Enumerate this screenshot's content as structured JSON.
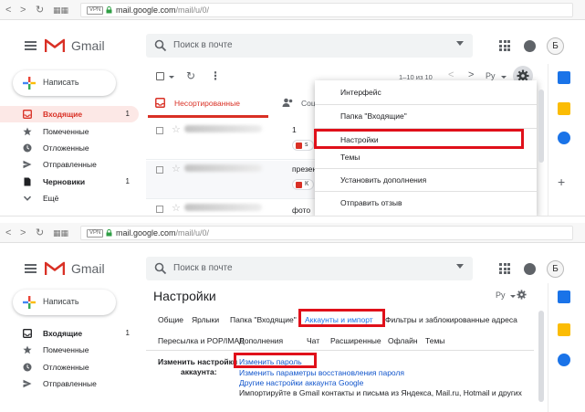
{
  "browser": {
    "vpn": "VPN",
    "url_host": "mail.google.com",
    "url_path": "/mail/u/0/"
  },
  "header": {
    "brand": "Gmail",
    "search_placeholder": "Поиск в почте",
    "avatar_letter": "Б"
  },
  "sidebar": {
    "compose_label": "Написать",
    "items": [
      {
        "label": "Входящие",
        "count": "1",
        "icon": "inbox-icon"
      },
      {
        "label": "Помеченные",
        "count": "",
        "icon": "star-icon"
      },
      {
        "label": "Отложенные",
        "count": "",
        "icon": "clock-icon"
      },
      {
        "label": "Отправленные",
        "count": "",
        "icon": "send-icon"
      },
      {
        "label": "Черновики",
        "count": "1",
        "icon": "draft-icon"
      },
      {
        "label": "Ещё",
        "count": "",
        "icon": "chevron-down-icon"
      }
    ]
  },
  "list": {
    "pagination": "1–10 из 10",
    "lang": "Ру",
    "tab_primary": "Несортированные",
    "tab_social": "Соц",
    "rows": [
      {
        "snippet": "1",
        "chip": "s"
      },
      {
        "snippet": "презен",
        "chip": "К"
      },
      {
        "snippet": "фото",
        "chip": ""
      }
    ]
  },
  "settings_menu": {
    "items": [
      "Интерфейс",
      "Папка \"Входящие\"",
      "Настройки",
      "Темы",
      "Установить дополнения",
      "Отправить отзыв"
    ]
  },
  "settings_page": {
    "title": "Настройки",
    "lang": "Ру",
    "tabs_row1": [
      "Общие",
      "Ярлыки",
      "Папка \"Входящие\"",
      "Аккаунты и импорт",
      "Фильтры и заблокированные адреса"
    ],
    "tabs_row2": [
      "Пересылка и POP/IMAP",
      "Дополнения",
      "Чат",
      "Расширенные",
      "Офлайн",
      "Темы"
    ],
    "section_label_line1": "Изменить настройки",
    "section_label_line2": "аккаунта:",
    "links": [
      "Изменить пароль",
      "Изменить параметры восстановления пароля",
      "Другие настройки аккаунта Google"
    ],
    "import_text": "Импортируйте в Gmail контакты и письма из Яндекса, Mail.ru, Hotmail и других"
  },
  "colors": {
    "gmail_red": "#d93025",
    "highlight": "#e0101a",
    "link": "#1155cc",
    "active_tab": "#1a73e8"
  }
}
